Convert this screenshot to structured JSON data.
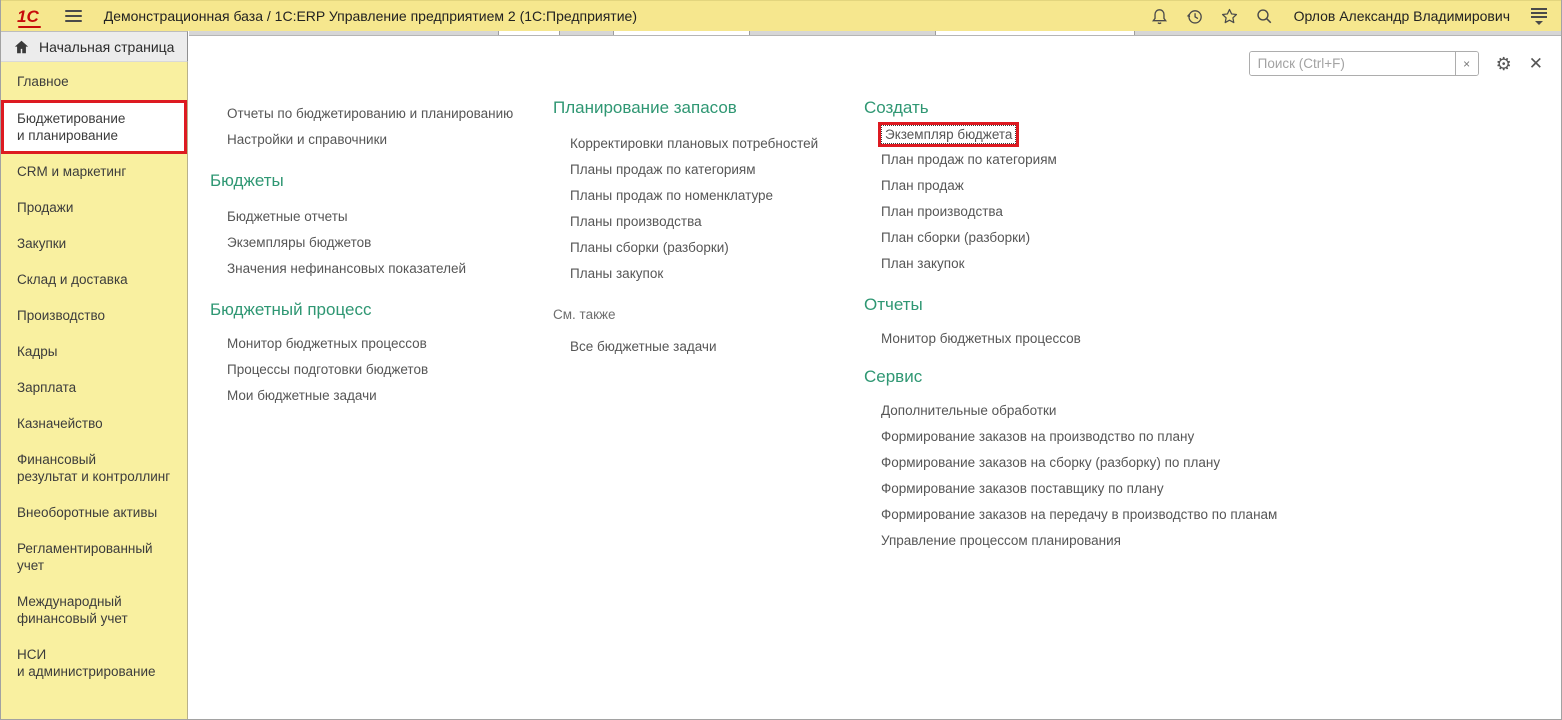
{
  "window": {
    "logo": "1С",
    "title": "Демонстрационная база / 1С:ERP Управление предприятием 2  (1С:Предприятие)",
    "user_name": "Орлов Александр Владимирович"
  },
  "icons": {
    "gear": "⚙",
    "close": "✕",
    "clear": "×"
  },
  "home_tab": {
    "label": "Начальная страница"
  },
  "sidebar": {
    "items": [
      {
        "label": "Главное",
        "selected": false
      },
      {
        "label": "Бюджетирование\nи планирование",
        "selected": true
      },
      {
        "label": "CRM и маркетинг",
        "selected": false
      },
      {
        "label": "Продажи",
        "selected": false
      },
      {
        "label": "Закупки",
        "selected": false
      },
      {
        "label": "Склад и доставка",
        "selected": false
      },
      {
        "label": "Производство",
        "selected": false
      },
      {
        "label": "Кадры",
        "selected": false
      },
      {
        "label": "Зарплата",
        "selected": false
      },
      {
        "label": "Казначейство",
        "selected": false
      },
      {
        "label": "Финансовый\nрезультат и контроллинг",
        "selected": false
      },
      {
        "label": "Внеоборотные активы",
        "selected": false
      },
      {
        "label": "Регламентированный\nучет",
        "selected": false
      },
      {
        "label": "Международный\nфинансовый учет",
        "selected": false
      },
      {
        "label": "НСИ\nи администрирование",
        "selected": false
      }
    ]
  },
  "panel": {
    "search_placeholder": "Поиск (Ctrl+F)"
  },
  "menu": {
    "col1": {
      "top_links": [
        "Отчеты по бюджетированию и планированию",
        "Настройки и справочники"
      ],
      "sections": [
        {
          "header": "Бюджеты",
          "links": [
            "Бюджетные отчеты",
            "Экземпляры бюджетов",
            "Значения нефинансовых показателей"
          ]
        },
        {
          "header": "Бюджетный процесс",
          "links": [
            "Монитор бюджетных процессов",
            "Процессы подготовки бюджетов",
            "Мои бюджетные задачи"
          ]
        }
      ]
    },
    "col2": {
      "section": {
        "header": "Планирование запасов",
        "links": [
          "Корректировки плановых потребностей",
          "Планы продаж по категориям",
          "Планы продаж по номенклатуре",
          "Планы производства",
          "Планы сборки (разборки)",
          "Планы закупок"
        ]
      },
      "see_also": {
        "header": "См. также",
        "links": [
          "Все бюджетные задачи"
        ]
      }
    },
    "col3": {
      "create": {
        "header": "Создать",
        "highlighted_link": "Экземпляр бюджета",
        "links": [
          "План продаж по категориям",
          "План продаж",
          "План производства",
          "План сборки (разборки)",
          "План закупок"
        ]
      },
      "reports": {
        "header": "Отчеты",
        "links": [
          "Монитор бюджетных процессов"
        ]
      },
      "service": {
        "header": "Сервис",
        "links": [
          "Дополнительные обработки",
          "Формирование заказов на производство по плану",
          "Формирование заказов на сборку (разборку) по плану",
          "Формирование заказов поставщику по плану",
          "Формирование заказов на передачу в производство по планам",
          "Управление процессом планирования"
        ]
      }
    }
  },
  "colors": {
    "accent_green": "#2f9773",
    "annotation_red": "#dd1a21",
    "topbar_yellow": "#f6e78e",
    "sidebar_yellow": "#f9f0a0"
  }
}
